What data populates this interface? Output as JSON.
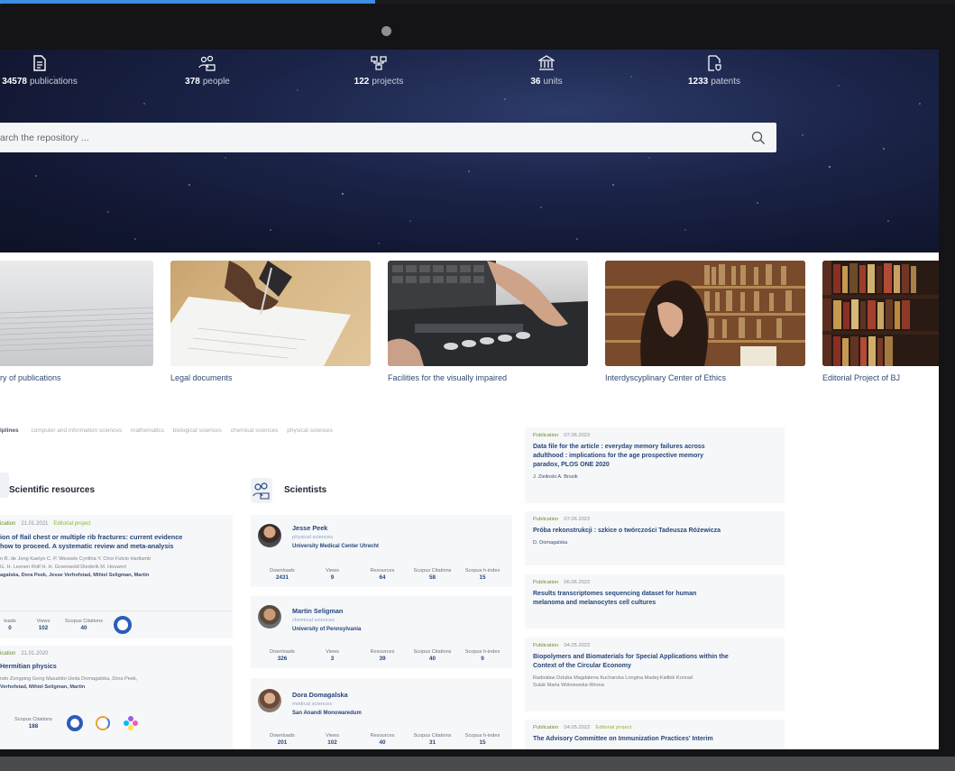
{
  "stats": [
    {
      "icon": "document-icon",
      "value": "34578",
      "label": "publications"
    },
    {
      "icon": "people-icon",
      "value": "378",
      "label": "people"
    },
    {
      "icon": "projects-icon",
      "value": "122",
      "label": "projects"
    },
    {
      "icon": "building-icon",
      "value": "36",
      "label": "units"
    },
    {
      "icon": "patent-icon",
      "value": "1233",
      "label": "patents"
    }
  ],
  "search": {
    "placeholder": "arch the repository ..."
  },
  "tiles": [
    {
      "caption": "ry of publications"
    },
    {
      "caption": "Legal documents"
    },
    {
      "caption": "Facilities for the visually impaired"
    },
    {
      "caption": "Interdyscyplinary Center of Ethics"
    },
    {
      "caption": "Editorial Project of BJ"
    }
  ],
  "filters": {
    "label": "iplines",
    "items": [
      "computer and information sciences",
      "mathematics",
      "biological sciences",
      "chemical sciences",
      "physical sciences"
    ]
  },
  "resources": {
    "title": "Scientific resources",
    "items": [
      {
        "type": "ication",
        "date": "21.01.2021",
        "extra": "Editorial project",
        "title_l1": "ion of flail chest or multiple rib fractures: current evidence",
        "title_l2": "how to proceed. A systematic review and meta-analysis",
        "auth_l1": "n R. de Jong   Kaelyn C. P. Wessels   Cynthia Y. Chor   Fulvio Hartlamb",
        "auth_l2": "G. H. Leenen   Rolf H. H. Groenwold   Diederik M. Houwert",
        "auth_l3": "agalska, Dora   Peek, Jesse   Verhofstad, Mihiel   Seligman, Martin",
        "stats": [
          {
            "label": "loads",
            "value": "0"
          },
          {
            "label": "Views",
            "value": "102"
          },
          {
            "label": "Scopus Citations",
            "value": "40"
          }
        ]
      },
      {
        "type": "ication",
        "date": "21.01.2020",
        "title_l1": "Hermitian physics",
        "auth_l1": "ndo   Zongping Gong   Masahito Ueda   Domagalska, Dora   Peek,",
        "auth_l2": "  Verhofstad, Mihiel   Seligman, Martin",
        "stats": [
          {
            "label": "Scopus Citations",
            "value": "188"
          }
        ]
      }
    ]
  },
  "scientists": {
    "title": "Scientists",
    "stat_labels": [
      "Downloads",
      "Views",
      "Resources",
      "Scopus Citations",
      "Scopus h-index"
    ],
    "people": [
      {
        "name": "Jesse Peek",
        "area": "physical sciences",
        "unit": "University Medical Center Utrecht",
        "values": [
          "2431",
          "9",
          "64",
          "58",
          "15"
        ]
      },
      {
        "name": "Martin Seligman",
        "area": "chemical sciences",
        "unit": "University of Pennsylvania",
        "values": [
          "326",
          "3",
          "39",
          "40",
          "9"
        ]
      },
      {
        "name": "Dora Domagalska",
        "area": "medical sciences",
        "unit": "San Anandi Monowaredum",
        "values": [
          "201",
          "102",
          "40",
          "31",
          "15"
        ]
      }
    ]
  },
  "feed": [
    {
      "type": "Publication",
      "date": "07.06.2022",
      "title_l1": "Data file for the article : everyday memory failures across",
      "title_l2": "adulthood : implications for the age prospective memory",
      "title_l3": "paradox, PLOS ONE 2020",
      "authors": "J. Zielinski   A. Brozik"
    },
    {
      "type": "Publication",
      "date": "07.06.2022",
      "title_l1": "Próba rekonstrukcji : szkice o twórczości Tadeusza Różewicza",
      "authors": "D. Domagalska"
    },
    {
      "type": "Publication",
      "date": "06.06.2022",
      "title_l1": "Results transcriptomes sequencing dataset for human",
      "title_l2": "melanoma and melanocytes cell cultures"
    },
    {
      "type": "Publication",
      "date": "04.05.2022",
      "title_l1": "Biopolymers and Biomaterials for Special Applications within the",
      "title_l2": "Context of the Circular Economy",
      "authors": "Radosław Dziuba   Magdalena Kucharska   Longina Madej-Kiełbik   Konrad",
      "authors_l2": "Sulak   Maria Wiśniewska-Wrona"
    },
    {
      "type": "Publication",
      "date": "04.05.2022",
      "extra": "Editorial project",
      "title_l1": "The Advisory Committee on Immunization Practices' Interim"
    }
  ],
  "colors": {
    "accent": "#27477a",
    "green": "#6b8f2a",
    "hero": "#161c3a",
    "frame": "#141416"
  }
}
